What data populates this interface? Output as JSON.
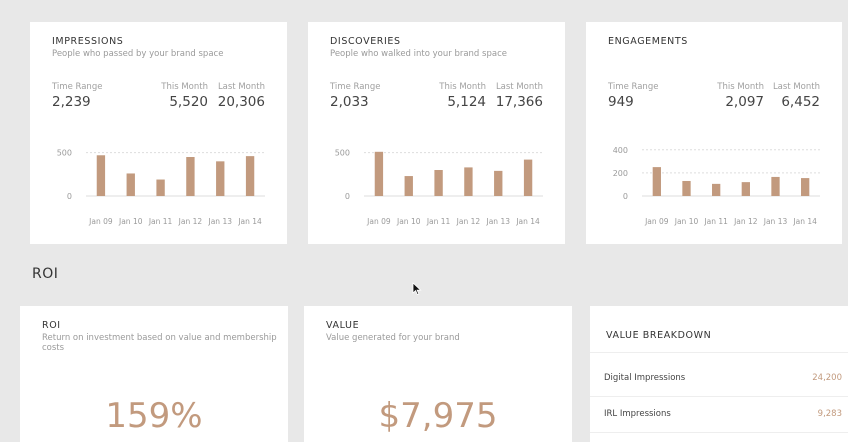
{
  "cards": [
    {
      "title": "IMPRESSIONS",
      "subtitle": "People who passed by your brand space",
      "stats": [
        {
          "label": "Time Range",
          "value": "2,239"
        },
        {
          "label": "This Month",
          "value": "5,520"
        },
        {
          "label": "Last Month",
          "value": "20,306"
        }
      ]
    },
    {
      "title": "DISCOVERIES",
      "subtitle": "People who walked into your brand space",
      "stats": [
        {
          "label": "Time Range",
          "value": "2,033"
        },
        {
          "label": "This Month",
          "value": "5,124"
        },
        {
          "label": "Last Month",
          "value": "17,366"
        }
      ]
    },
    {
      "title": "ENGAGEMENTS",
      "subtitle": "",
      "stats": [
        {
          "label": "Time Range",
          "value": "949"
        },
        {
          "label": "This Month",
          "value": "2,097"
        },
        {
          "label": "Last Month",
          "value": "6,452"
        }
      ]
    }
  ],
  "chart_data": [
    {
      "type": "bar",
      "categories": [
        "Jan 09",
        "Jan 10",
        "Jan 11",
        "Jan 12",
        "Jan 13",
        "Jan 14"
      ],
      "values": [
        470,
        260,
        190,
        450,
        400,
        460
      ],
      "yticks": [
        0,
        500
      ],
      "ylim": [
        0,
        600
      ],
      "grid": true
    },
    {
      "type": "bar",
      "categories": [
        "Jan 09",
        "Jan 10",
        "Jan 11",
        "Jan 12",
        "Jan 13",
        "Jan 14"
      ],
      "values": [
        510,
        230,
        300,
        330,
        290,
        420
      ],
      "yticks": [
        0,
        500
      ],
      "ylim": [
        0,
        600
      ],
      "grid": true
    },
    {
      "type": "bar",
      "categories": [
        "Jan 09",
        "Jan 10",
        "Jan 11",
        "Jan 12",
        "Jan 13",
        "Jan 14"
      ],
      "values": [
        250,
        130,
        105,
        120,
        165,
        155
      ],
      "yticks": [
        0,
        200,
        400
      ],
      "ylim": [
        0,
        450
      ],
      "grid": true
    }
  ],
  "section": {
    "title": "ROI"
  },
  "roi": {
    "title": "ROI",
    "subtitle": "Return on investment based on value and membership costs",
    "value": "159%"
  },
  "value_card": {
    "title": "VALUE",
    "subtitle": "Value generated for your brand",
    "value": "$7,975"
  },
  "breakdown": {
    "title": "VALUE BREAKDOWN",
    "rows": [
      {
        "label": "Digital Impressions",
        "value": "24,200"
      },
      {
        "label": "IRL Impressions",
        "value": "9,283"
      }
    ]
  },
  "colors": {
    "bar": "#c29a7e",
    "accent": "#c29a7e",
    "grid": "#dddddd",
    "axis_text": "#9a9a9a"
  }
}
